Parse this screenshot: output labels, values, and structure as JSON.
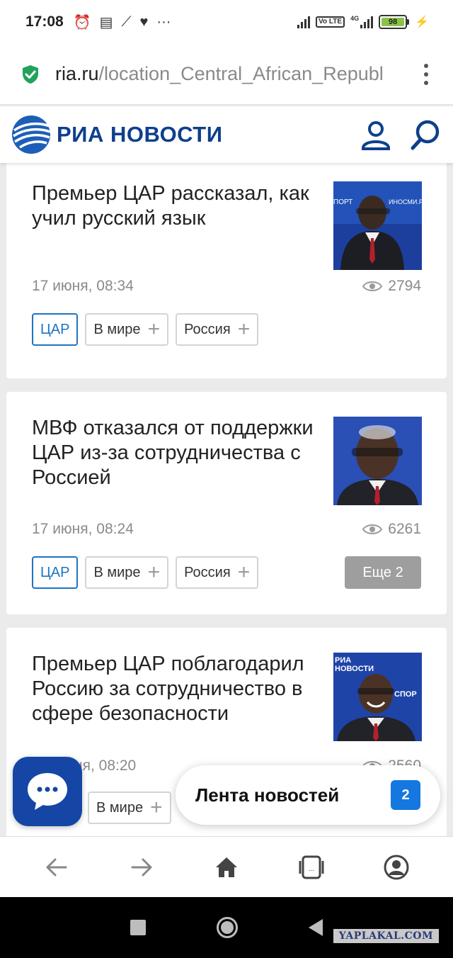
{
  "status_bar": {
    "time": "17:08",
    "battery": "98",
    "network": "4G",
    "volte": "Vo LTE",
    "icons": [
      "alarm-icon",
      "message-icon",
      "shoe-icon",
      "heart-icon",
      "more-icon"
    ]
  },
  "browser": {
    "url_host": "ria.ru",
    "url_path": "/location_Central_African_Republ",
    "secure_icon": "shield-check-icon",
    "menu_icon": "kebab-menu-icon"
  },
  "site": {
    "logo_text": "РИА НОВОСТИ",
    "brand_color": "#0e3f8c"
  },
  "articles": [
    {
      "title": "Премьер ЦАР рассказал, как учил русский язык",
      "date": "17 июня, 08:34",
      "views": "2794",
      "tags": [
        {
          "label": "ЦАР",
          "active": true
        },
        {
          "label": "В мире",
          "active": false
        },
        {
          "label": "Россия",
          "active": false
        }
      ]
    },
    {
      "title": "МВФ отказался от поддержки ЦАР из-за сотрудничества с Россией",
      "date": "17 июня, 08:24",
      "views": "6261",
      "tags": [
        {
          "label": "ЦАР",
          "active": true
        },
        {
          "label": "В мире",
          "active": false
        },
        {
          "label": "Россия",
          "active": false
        }
      ],
      "more_label": "Еще 2"
    },
    {
      "title": "Премьер ЦАР поблагодарил Россию за сотрудничество в сфере безопасности",
      "date_partial": "ня, 08:20",
      "views_partial": "2560",
      "tags": [
        {
          "label": "В мире",
          "active": false
        }
      ]
    }
  ],
  "floating": {
    "news_feed_label": "Лента новостей",
    "news_feed_count": "2"
  },
  "watermark": "YAPLAKAL.COM"
}
